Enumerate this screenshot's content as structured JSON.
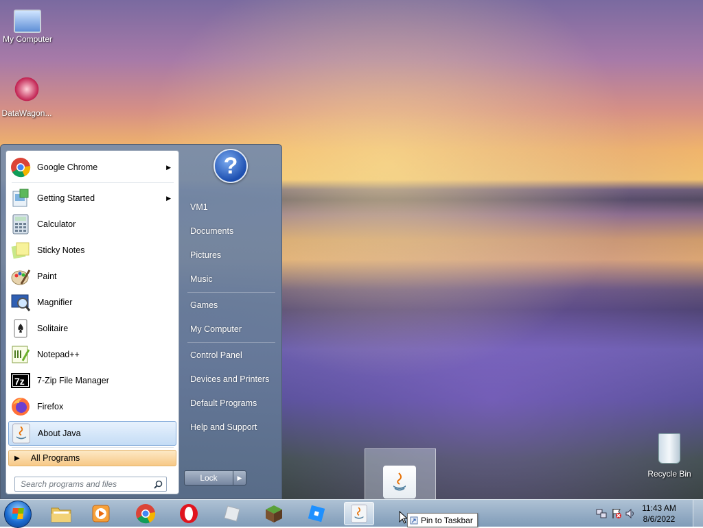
{
  "desktop": {
    "icons": [
      {
        "label": "My Computer"
      },
      {
        "label": "DataWagon..."
      },
      {
        "label": "Recycle Bin"
      }
    ]
  },
  "start_menu": {
    "programs": [
      {
        "label": "Google Chrome",
        "icon": "chrome-icon",
        "has_submenu": true
      },
      {
        "label": "Getting Started",
        "icon": "getting-started-icon",
        "has_submenu": true
      },
      {
        "label": "Calculator",
        "icon": "calculator-icon"
      },
      {
        "label": "Sticky Notes",
        "icon": "sticky-notes-icon"
      },
      {
        "label": "Paint",
        "icon": "paint-icon"
      },
      {
        "label": "Magnifier",
        "icon": "magnifier-icon"
      },
      {
        "label": "Solitaire",
        "icon": "solitaire-icon"
      },
      {
        "label": "Notepad++",
        "icon": "notepadpp-icon"
      },
      {
        "label": "7-Zip File Manager",
        "icon": "7zip-icon"
      },
      {
        "label": "Firefox",
        "icon": "firefox-icon"
      },
      {
        "label": "About Java",
        "icon": "java-icon",
        "selected": true
      }
    ],
    "all_programs": "All Programs",
    "search_placeholder": "Search programs and files",
    "right_links": [
      "VM1",
      "Documents",
      "Pictures",
      "Music",
      "Games",
      "My Computer",
      "Control Panel",
      "Devices and Printers",
      "Default Programs",
      "Help and Support"
    ],
    "lock_label": "Lock"
  },
  "taskbar": {
    "pinned": [
      "file-explorer-icon",
      "media-player-icon",
      "chrome-icon",
      "opera-icon",
      "roblox-studio-icon",
      "minecraft-icon",
      "roblox-icon",
      "java-icon"
    ],
    "tooltip": "Pin to Taskbar",
    "clock_time": "11:43 AM",
    "clock_date": "8/6/2022"
  },
  "colors": {
    "selected_item": "#c4dcf5",
    "all_programs_highlight": "#f7c987",
    "help_blue": "#1d4fb0"
  }
}
